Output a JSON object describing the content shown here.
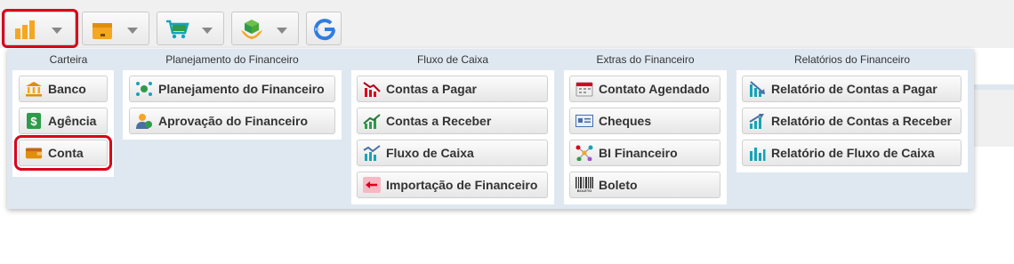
{
  "toolbar": {
    "buttons": [
      {
        "name": "financeiro-button",
        "icon": "bar-chart-icon",
        "selected": true
      },
      {
        "name": "estoque-button",
        "icon": "box-icon",
        "selected": false
      },
      {
        "name": "vendas-button",
        "icon": "shopping-cart-icon",
        "selected": false
      },
      {
        "name": "servicos-button",
        "icon": "hands-cube-icon",
        "selected": false
      },
      {
        "name": "google-button",
        "icon": "google-icon",
        "selected": false
      }
    ]
  },
  "menu": {
    "carteira": {
      "title": "Carteira",
      "items": [
        {
          "label": "Banco",
          "icon": "bank-icon"
        },
        {
          "label": "Agência",
          "icon": "dollar-icon"
        },
        {
          "label": "Conta",
          "icon": "wallet-icon",
          "selected": true
        }
      ]
    },
    "planejamento": {
      "title": "Planejamento do Financeiro",
      "items": [
        {
          "label": "Planejamento do Financeiro",
          "icon": "planning-icon"
        },
        {
          "label": "Aprovação do Financeiro",
          "icon": "user-approve-icon"
        }
      ]
    },
    "fluxo": {
      "title": "Fluxo de Caixa",
      "items": [
        {
          "label": "Contas a Pagar",
          "icon": "chart-down-icon"
        },
        {
          "label": "Contas a Receber",
          "icon": "chart-up-icon"
        },
        {
          "label": "Fluxo de Caixa",
          "icon": "cash-flow-icon"
        },
        {
          "label": "Importação de Financeiro",
          "icon": "import-icon"
        }
      ]
    },
    "extras": {
      "title": "Extras do Financeiro",
      "items": [
        {
          "label": "Contato Agendado",
          "icon": "calendar-icon"
        },
        {
          "label": "Cheques",
          "icon": "check-icon"
        },
        {
          "label": "BI Financeiro",
          "icon": "network-icon"
        },
        {
          "label": "Boleto",
          "icon": "barcode-icon",
          "icon_text": "BOLETO"
        }
      ]
    },
    "relatorios": {
      "title": "Relatórios do Financeiro",
      "items": [
        {
          "label": "Relatório de Contas a Pagar",
          "icon": "report-down-icon"
        },
        {
          "label": "Relatório de Contas a Receber",
          "icon": "report-up-icon"
        },
        {
          "label": "Relatório de Fluxo de Caixa",
          "icon": "report-flow-icon"
        }
      ]
    }
  },
  "colors": {
    "selection": "#d9001b",
    "menu_bg": "#dfe8f1",
    "orange": "#f5a623",
    "teal": "#16a3b8",
    "green": "#2e9b4a",
    "red": "#d9001b"
  }
}
